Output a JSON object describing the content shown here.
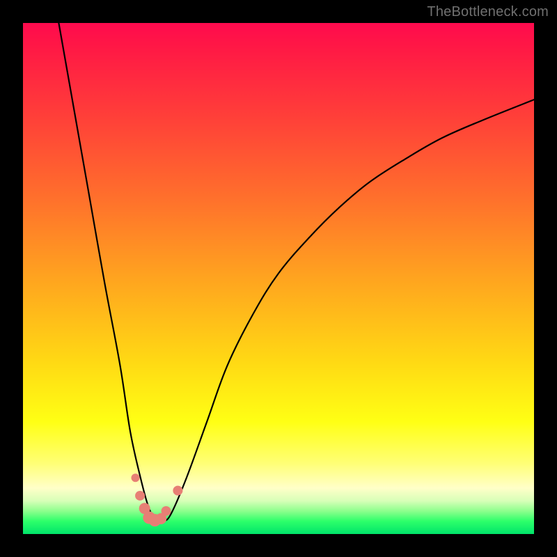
{
  "watermark": "TheBottleneck.com",
  "colors": {
    "frame": "#000000",
    "curve": "#000000",
    "marker": "#e77f75",
    "gradient_stops": [
      "#ff0a4e",
      "#ff3e39",
      "#ffa41f",
      "#ffff14",
      "#ffffc8",
      "#2dff6a",
      "#00e46a"
    ]
  },
  "chart_data": {
    "type": "line",
    "title": "",
    "xlabel": "",
    "ylabel": "",
    "xlim": [
      0,
      100
    ],
    "ylim": [
      0,
      100
    ],
    "grid": false,
    "legend": false,
    "series": [
      {
        "name": "bottleneck-curve",
        "x": [
          7,
          10,
          13,
          16,
          19,
          21,
          23,
          24.5,
          26,
          27.5,
          29,
          32,
          36,
          40,
          45,
          50,
          56,
          62,
          68,
          75,
          82,
          90,
          100
        ],
        "values": [
          100,
          83,
          66,
          49,
          33,
          20,
          11,
          5.5,
          2.5,
          2.5,
          4,
          11,
          22,
          33,
          43,
          51,
          58,
          64,
          69,
          73.5,
          77.5,
          81,
          85
        ]
      }
    ],
    "markers": {
      "name": "highlighted-points",
      "x": [
        22.0,
        22.9,
        23.8,
        24.7,
        25.8,
        27.0,
        28.0,
        30.3
      ],
      "values": [
        11.0,
        7.5,
        5.0,
        3.2,
        2.7,
        3.0,
        4.5,
        8.5
      ]
    }
  }
}
